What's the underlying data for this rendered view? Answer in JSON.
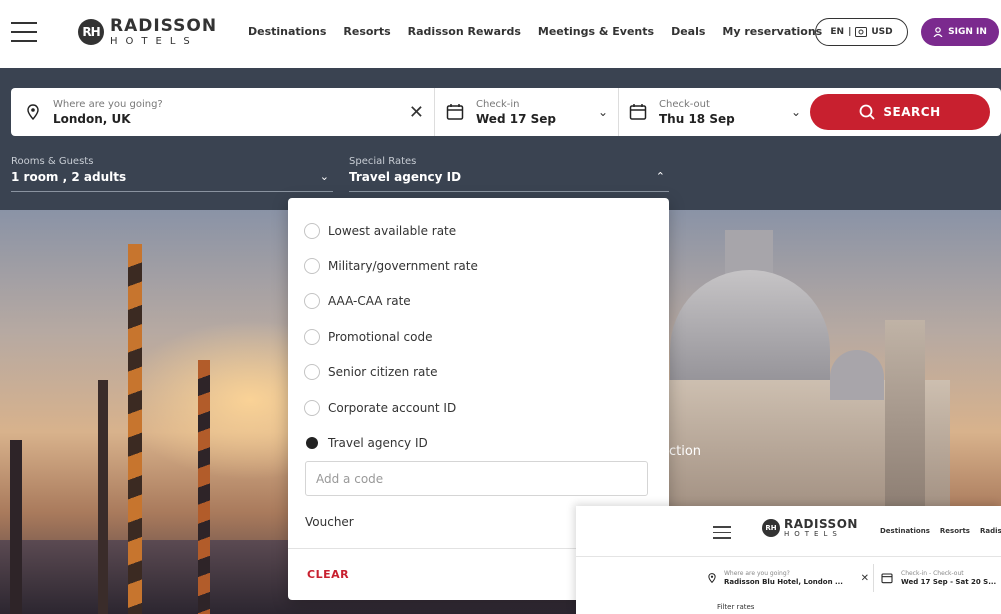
{
  "header": {
    "logo_brand": "RADISSON",
    "logo_sub": "HOTELS",
    "logo_mark": "RH",
    "nav": [
      "Destinations",
      "Resorts",
      "Radisson Rewards",
      "Meetings & Events",
      "Deals",
      "My reservations"
    ],
    "lang": "EN",
    "currency": "USD",
    "sign_in": "SIGN IN",
    "accent_color": "#7b2a8e"
  },
  "search": {
    "location_label": "Where are you going?",
    "location_value": "London, UK",
    "checkin_label": "Check-in",
    "checkin_value": "Wed 17 Sep",
    "checkout_label": "Check-out",
    "checkout_value": "Thu 18 Sep",
    "search_button": "SEARCH",
    "search_color": "#c8202f",
    "rooms_label": "Rooms & Guests",
    "rooms_value": "1 room , 2 adults",
    "rates_label": "Special Rates",
    "rates_value": "Travel agency ID"
  },
  "rates_dropdown": {
    "options": [
      {
        "label": "Lowest available rate",
        "checked": false
      },
      {
        "label": "Military/government rate",
        "checked": false
      },
      {
        "label": "AAA-CAA rate",
        "checked": false
      },
      {
        "label": "Promotional code",
        "checked": false
      },
      {
        "label": "Senior citizen rate",
        "checked": false
      },
      {
        "label": "Corporate account ID",
        "checked": false
      },
      {
        "label": "Travel agency ID",
        "checked": true
      }
    ],
    "code_placeholder": "Add a code",
    "voucher": "Voucher",
    "clear": "CLEAR"
  },
  "hero": {
    "visible_text": "ction"
  },
  "mini_overlay": {
    "logo_brand": "RADISSON",
    "logo_sub": "HOTELS",
    "logo_mark": "RH",
    "nav": [
      "Destinations",
      "Resorts",
      "Radiss"
    ],
    "location_label": "Where are you going?",
    "location_value": "Radisson Blu Hotel, London ...",
    "dates_label": "Check-in - Check-out",
    "dates_value": "Wed 17 Sep - Sat 20 S...",
    "filter_label": "Filter rates"
  }
}
